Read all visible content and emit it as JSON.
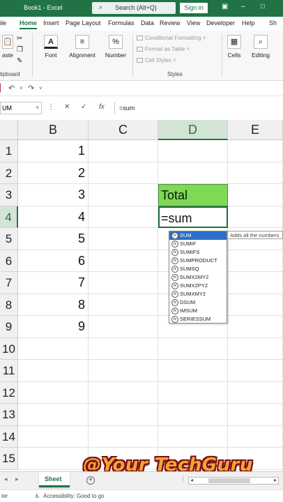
{
  "title": {
    "doc_name": "Book1 - Excel",
    "search_placeholder": "Search (Alt+Q)",
    "sign_in": "Sign in"
  },
  "tabs": [
    "ile",
    "Home",
    "Insert",
    "Page Layout",
    "Formulas",
    "Data",
    "Review",
    "View",
    "Developer",
    "Help",
    "Sh"
  ],
  "active_tab": "Home",
  "ribbon": {
    "paste_label": "aste",
    "clipboard_label": "lipboard",
    "font_label": "Font",
    "alignment_label": "Alignment",
    "number_label": "Number",
    "number_symbol": "%",
    "conditional_formatting": "Conditional Formatting",
    "format_as_table": "Format as Table",
    "cell_styles": "Cell Styles",
    "styles_label": "Styles",
    "cells_label": "Cells",
    "editing_label": "Editing"
  },
  "name_box": "UM",
  "formula_bar_value": "=sum",
  "columns": [
    "B",
    "C",
    "D",
    "E"
  ],
  "selected_column": "D",
  "rows": [
    "1",
    "2",
    "3",
    "4",
    "5",
    "6",
    "7",
    "8",
    "9",
    "10",
    "11",
    "12",
    "13",
    "14",
    "15"
  ],
  "selected_row": "4",
  "column_b_values": [
    "1",
    "2",
    "3",
    "4",
    "5",
    "6",
    "7",
    "8",
    "9"
  ],
  "total_cell": "Total",
  "active_cell_value": "=sum",
  "autocomplete": {
    "items": [
      "SUM",
      "SUMIF",
      "SUMIFS",
      "SUMPRODUCT",
      "SUMSQ",
      "SUMX2MY2",
      "SUMX2PY2",
      "SUMXMY2",
      "DSUM",
      "IMSUM",
      "SERIESSUM"
    ],
    "selected": "SUM",
    "tooltip": "Adds all the numbers"
  },
  "sheet_tab": "Sheet",
  "status": {
    "left": "ter",
    "accessibility": "Accessibility: Good to go"
  },
  "watermark": "@Your TechGuru",
  "colors": {
    "excel_green": "#217346",
    "total_fill": "#7ed957",
    "autocomplete_selected": "#2b6fc7",
    "watermark_fill": "#f4a23a"
  }
}
